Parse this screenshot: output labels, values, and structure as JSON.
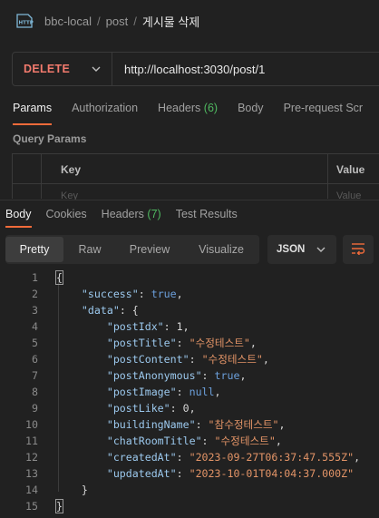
{
  "breadcrumb": {
    "items": [
      "bbc-local",
      "post"
    ],
    "separator": "/",
    "current": "게시물 삭제",
    "icon": "http-icon"
  },
  "request": {
    "method": "DELETE",
    "url": "http://localhost:3030/post/1"
  },
  "request_tabs": [
    {
      "label": "Params",
      "active": true
    },
    {
      "label": "Authorization"
    },
    {
      "label": "Headers",
      "count": "(6)"
    },
    {
      "label": "Body"
    },
    {
      "label": "Pre-request Scr"
    }
  ],
  "query_params": {
    "title": "Query Params",
    "columns": [
      "Key",
      "Value"
    ],
    "placeholders": [
      "Key",
      "Value"
    ]
  },
  "response_tabs": [
    {
      "label": "Body",
      "active": true
    },
    {
      "label": "Cookies"
    },
    {
      "label": "Headers",
      "count": "(7)"
    },
    {
      "label": "Test Results"
    }
  ],
  "view_modes": [
    "Pretty",
    "Raw",
    "Preview",
    "Visualize"
  ],
  "active_view": "Pretty",
  "format": "JSON",
  "code_lines": [
    {
      "n": "1",
      "parts": [
        {
          "t": "{",
          "c": "brace"
        }
      ]
    },
    {
      "n": "2",
      "parts": [
        {
          "t": "    "
        },
        {
          "t": "\"success\"",
          "c": "key"
        },
        {
          "t": ": ",
          "c": "punc"
        },
        {
          "t": "true",
          "c": "bool"
        },
        {
          "t": ",",
          "c": "punc"
        }
      ]
    },
    {
      "n": "3",
      "parts": [
        {
          "t": "    "
        },
        {
          "t": "\"data\"",
          "c": "key"
        },
        {
          "t": ": {",
          "c": "punc"
        }
      ]
    },
    {
      "n": "4",
      "parts": [
        {
          "t": "        "
        },
        {
          "t": "\"postIdx\"",
          "c": "key"
        },
        {
          "t": ": ",
          "c": "punc"
        },
        {
          "t": "1",
          "c": "num"
        },
        {
          "t": ",",
          "c": "punc"
        }
      ]
    },
    {
      "n": "5",
      "parts": [
        {
          "t": "        "
        },
        {
          "t": "\"postTitle\"",
          "c": "key"
        },
        {
          "t": ": ",
          "c": "punc"
        },
        {
          "t": "\"수정테스트\"",
          "c": "str"
        },
        {
          "t": ",",
          "c": "punc"
        }
      ]
    },
    {
      "n": "6",
      "parts": [
        {
          "t": "        "
        },
        {
          "t": "\"postContent\"",
          "c": "key"
        },
        {
          "t": ": ",
          "c": "punc"
        },
        {
          "t": "\"수정테스트\"",
          "c": "str"
        },
        {
          "t": ",",
          "c": "punc"
        }
      ]
    },
    {
      "n": "7",
      "parts": [
        {
          "t": "        "
        },
        {
          "t": "\"postAnonymous\"",
          "c": "key"
        },
        {
          "t": ": ",
          "c": "punc"
        },
        {
          "t": "true",
          "c": "bool"
        },
        {
          "t": ",",
          "c": "punc"
        }
      ]
    },
    {
      "n": "8",
      "parts": [
        {
          "t": "        "
        },
        {
          "t": "\"postImage\"",
          "c": "key"
        },
        {
          "t": ": ",
          "c": "punc"
        },
        {
          "t": "null",
          "c": "bool"
        },
        {
          "t": ",",
          "c": "punc"
        }
      ]
    },
    {
      "n": "9",
      "parts": [
        {
          "t": "        "
        },
        {
          "t": "\"postLike\"",
          "c": "key"
        },
        {
          "t": ": ",
          "c": "punc"
        },
        {
          "t": "0",
          "c": "num"
        },
        {
          "t": ",",
          "c": "punc"
        }
      ]
    },
    {
      "n": "10",
      "parts": [
        {
          "t": "        "
        },
        {
          "t": "\"buildingName\"",
          "c": "key"
        },
        {
          "t": ": ",
          "c": "punc"
        },
        {
          "t": "\"참수정테스트\"",
          "c": "str"
        },
        {
          "t": ",",
          "c": "punc"
        }
      ]
    },
    {
      "n": "11",
      "parts": [
        {
          "t": "        "
        },
        {
          "t": "\"chatRoomTitle\"",
          "c": "key"
        },
        {
          "t": ": ",
          "c": "punc"
        },
        {
          "t": "\"수정테스트\"",
          "c": "str"
        },
        {
          "t": ",",
          "c": "punc"
        }
      ]
    },
    {
      "n": "12",
      "parts": [
        {
          "t": "        "
        },
        {
          "t": "\"createdAt\"",
          "c": "key"
        },
        {
          "t": ": ",
          "c": "punc"
        },
        {
          "t": "\"2023-09-27T06:37:47.555Z\"",
          "c": "str"
        },
        {
          "t": ",",
          "c": "punc"
        }
      ]
    },
    {
      "n": "13",
      "parts": [
        {
          "t": "        "
        },
        {
          "t": "\"updatedAt\"",
          "c": "key"
        },
        {
          "t": ": ",
          "c": "punc"
        },
        {
          "t": "\"2023-10-01T04:04:37.000Z\"",
          "c": "str"
        }
      ]
    },
    {
      "n": "14",
      "parts": [
        {
          "t": "    "
        },
        {
          "t": "}",
          "c": "punc"
        }
      ]
    },
    {
      "n": "15",
      "parts": [
        {
          "t": "}",
          "c": "brace"
        }
      ]
    }
  ],
  "colors": {
    "method": "#f27a6d",
    "accent": "#f26b3a",
    "count": "#4fb860",
    "key": "#9cc9ee",
    "string": "#e39467",
    "keyword": "#6ca0dc"
  }
}
